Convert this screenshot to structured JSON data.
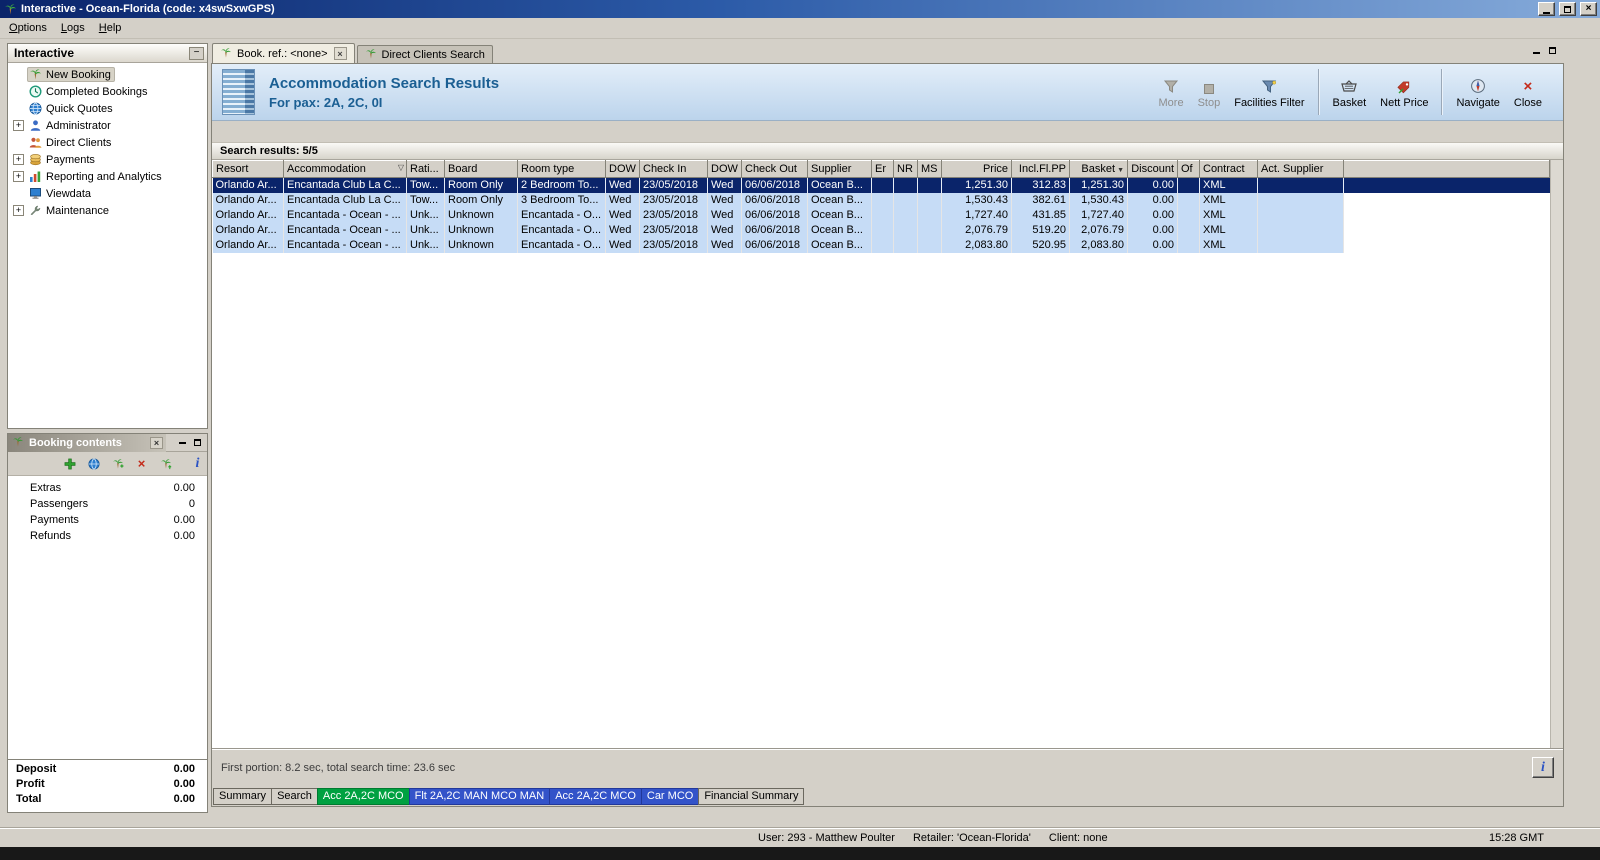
{
  "window": {
    "title": "Interactive - Ocean-Florida (code: x4swSxwGPS)"
  },
  "menu": {
    "items": [
      "Options",
      "Logs",
      "Help"
    ]
  },
  "sidebar": {
    "title": "Interactive",
    "items": [
      {
        "label": "New Booking",
        "expandable": false,
        "selected": true
      },
      {
        "label": "Completed Bookings",
        "expandable": false,
        "selected": false
      },
      {
        "label": "Quick Quotes",
        "expandable": false,
        "selected": false
      },
      {
        "label": "Administrator",
        "expandable": true,
        "selected": false
      },
      {
        "label": "Direct Clients",
        "expandable": false,
        "selected": false
      },
      {
        "label": "Payments",
        "expandable": true,
        "selected": false
      },
      {
        "label": "Reporting and Analytics",
        "expandable": true,
        "selected": false
      },
      {
        "label": "Viewdata",
        "expandable": false,
        "selected": false
      },
      {
        "label": "Maintenance",
        "expandable": true,
        "selected": false
      }
    ]
  },
  "booking_panel": {
    "title": "Booking contents",
    "rows": [
      {
        "label": "Extras",
        "value": "0.00"
      },
      {
        "label": "Passengers",
        "value": "0"
      },
      {
        "label": "Payments",
        "value": "0.00"
      },
      {
        "label": "Refunds",
        "value": "0.00"
      }
    ],
    "totals": [
      {
        "label": "Deposit",
        "value": "0.00"
      },
      {
        "label": "Profit",
        "value": "0.00"
      },
      {
        "label": "Total",
        "value": "0.00"
      }
    ]
  },
  "workspace": {
    "tabs": [
      {
        "label": "Book. ref.: <none>",
        "active": true
      },
      {
        "label": "Direct Clients Search",
        "active": false
      }
    ],
    "header": {
      "title": "Accommodation Search Results",
      "subtitle": "For pax: 2A, 2C, 0I"
    },
    "toolbar": {
      "more": "More",
      "stop": "Stop",
      "facilities_filter": "Facilities Filter",
      "basket": "Basket",
      "nett_price": "Nett Price",
      "navigate": "Navigate",
      "close": "Close"
    },
    "results_label": "Search results: 5/5",
    "footer_status": "First portion: 8.2 sec, total search time: 23.6 sec",
    "bottom_tabs": [
      {
        "label": "Summary",
        "style": "plain"
      },
      {
        "label": "Search",
        "style": "plain"
      },
      {
        "label": "Acc 2A,2C MCO",
        "style": "green"
      },
      {
        "label": "Flt 2A,2C MAN MCO MAN",
        "style": "blue"
      },
      {
        "label": "Acc 2A,2C MCO",
        "style": "blue"
      },
      {
        "label": "Car MCO",
        "style": "blue"
      },
      {
        "label": "Financial Summary",
        "style": "plain"
      }
    ]
  },
  "table": {
    "columns": [
      {
        "label": "Resort"
      },
      {
        "label": "Accommodation",
        "filter": true
      },
      {
        "label": "Rati..."
      },
      {
        "label": "Board"
      },
      {
        "label": "Room type"
      },
      {
        "label": "DOW"
      },
      {
        "label": "Check In"
      },
      {
        "label": "DOW"
      },
      {
        "label": "Check Out"
      },
      {
        "label": "Supplier"
      },
      {
        "label": "Er"
      },
      {
        "label": "NR"
      },
      {
        "label": "MS"
      },
      {
        "label": "Price"
      },
      {
        "label": "Incl.Fl.PP"
      },
      {
        "label": "Basket",
        "sort": true
      },
      {
        "label": "Discount"
      },
      {
        "label": "Of"
      },
      {
        "label": "Contract"
      },
      {
        "label": "Act. Supplier"
      }
    ],
    "rows": [
      {
        "selected": true,
        "cells": [
          "Orlando Ar...",
          "Encantada Club La C...",
          "Tow...",
          "Room Only",
          "2 Bedroom To...",
          "Wed",
          "23/05/2018",
          "Wed",
          "06/06/2018",
          "Ocean B...",
          "",
          "",
          "",
          "1,251.30",
          "312.83",
          "1,251.30",
          "0.00",
          "",
          "XML",
          ""
        ]
      },
      {
        "selected": false,
        "cells": [
          "Orlando Ar...",
          "Encantada Club La C...",
          "Tow...",
          "Room Only",
          "3 Bedroom To...",
          "Wed",
          "23/05/2018",
          "Wed",
          "06/06/2018",
          "Ocean B...",
          "",
          "",
          "",
          "1,530.43",
          "382.61",
          "1,530.43",
          "0.00",
          "",
          "XML",
          ""
        ]
      },
      {
        "selected": false,
        "cells": [
          "Orlando Ar...",
          "Encantada - Ocean - ...",
          "Unk...",
          "Unknown",
          "Encantada - O...",
          "Wed",
          "23/05/2018",
          "Wed",
          "06/06/2018",
          "Ocean B...",
          "",
          "",
          "",
          "1,727.40",
          "431.85",
          "1,727.40",
          "0.00",
          "",
          "XML",
          ""
        ]
      },
      {
        "selected": false,
        "cells": [
          "Orlando Ar...",
          "Encantada - Ocean - ...",
          "Unk...",
          "Unknown",
          "Encantada - O...",
          "Wed",
          "23/05/2018",
          "Wed",
          "06/06/2018",
          "Ocean B...",
          "",
          "",
          "",
          "2,076.79",
          "519.20",
          "2,076.79",
          "0.00",
          "",
          "XML",
          ""
        ]
      },
      {
        "selected": false,
        "cells": [
          "Orlando Ar...",
          "Encantada - Ocean - ...",
          "Unk...",
          "Unknown",
          "Encantada - O...",
          "Wed",
          "23/05/2018",
          "Wed",
          "06/06/2018",
          "Ocean B...",
          "",
          "",
          "",
          "2,083.80",
          "520.95",
          "2,083.80",
          "0.00",
          "",
          "XML",
          ""
        ]
      }
    ]
  },
  "statusbar": {
    "user": "User: 293 - Matthew Poulter",
    "retailer": "Retailer: 'Ocean-Florida'",
    "client": "Client: none",
    "time": "15:28 GMT"
  },
  "icons": {
    "app": "palm-tree",
    "tab": "palm-tree",
    "accommodation_filter": "funnel",
    "basket_sort": "triangle-down",
    "info": "letter-i",
    "close": "x"
  },
  "colors": {
    "titlebar": "#0a246a",
    "selected_row": "#0a246a",
    "result_row": "#c6dcf6",
    "header_text": "#1b5f93",
    "green_tab": "#00a141",
    "blue_tab": "#3353c9",
    "chrome": "#d4d0c8"
  }
}
